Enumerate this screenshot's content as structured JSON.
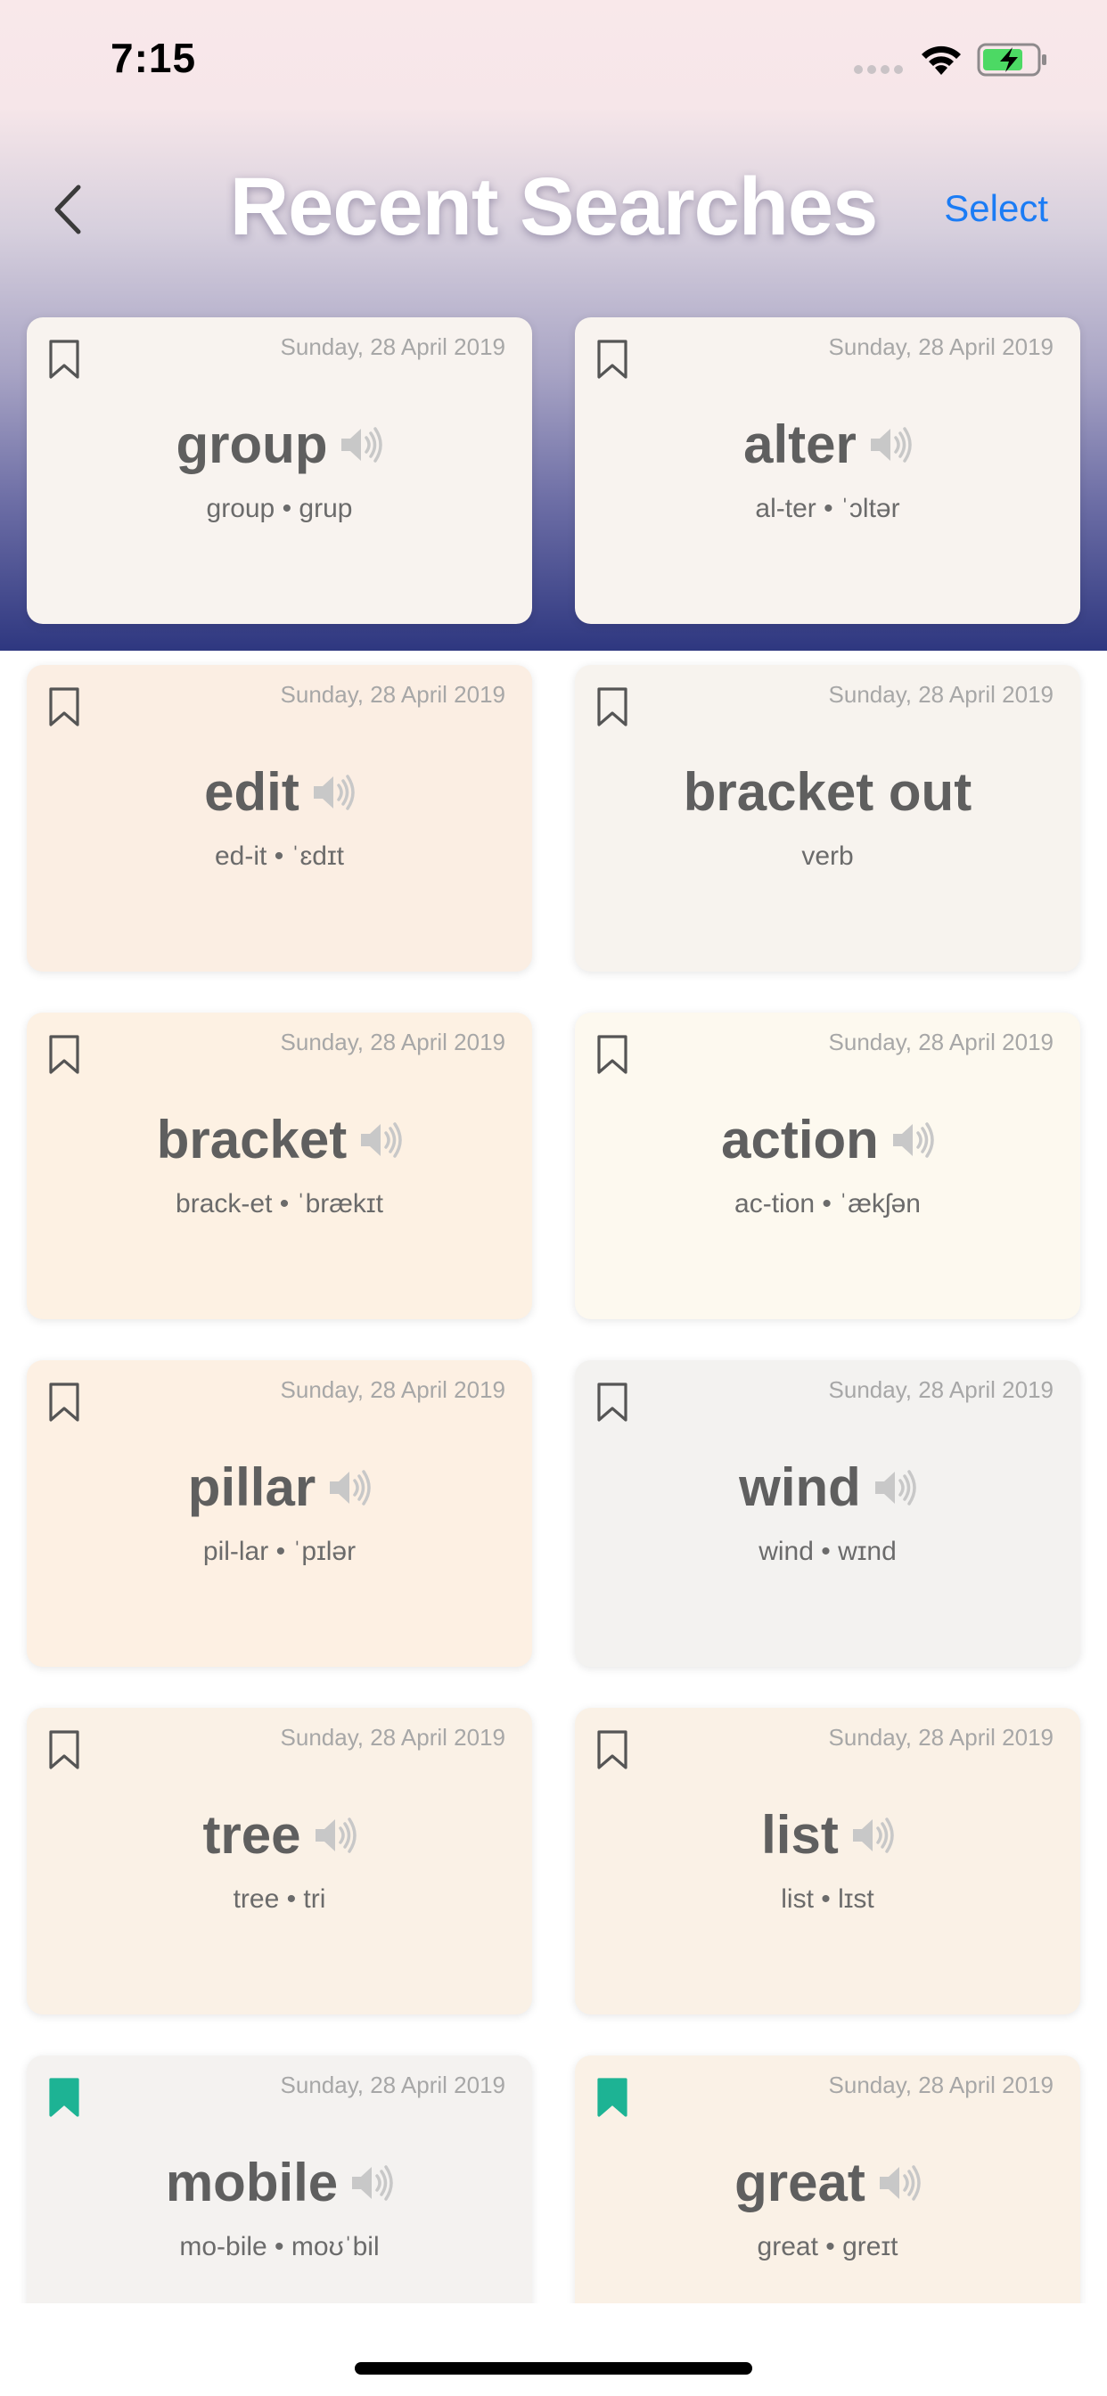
{
  "status_bar": {
    "time": "7:15"
  },
  "nav": {
    "title": "Recent Searches",
    "select_label": "Select"
  },
  "colors": {
    "accent": "#1b7cf5",
    "bookmark_saved": "#1db394",
    "bookmark_unsaved": "#555555"
  },
  "cards": [
    {
      "date": "Sunday, 28 April 2019",
      "word": "group",
      "pronunciation": "group • grup",
      "bookmarked": false,
      "has_audio": true,
      "bg": "#f8f3ef"
    },
    {
      "date": "Sunday, 28 April 2019",
      "word": "alter",
      "pronunciation": "al-ter • ˈɔltər",
      "bookmarked": false,
      "has_audio": true,
      "bg": "#f8f3ef"
    },
    {
      "date": "Sunday, 28 April 2019",
      "word": "edit",
      "pronunciation": "ed-it • ˈɛdɪt",
      "bookmarked": false,
      "has_audio": true,
      "bg": "#fbeee3"
    },
    {
      "date": "Sunday, 28 April 2019",
      "word": "bracket out",
      "pronunciation": "verb",
      "bookmarked": false,
      "has_audio": false,
      "bg": "#f7f3ee"
    },
    {
      "date": "Sunday, 28 April 2019",
      "word": "bracket",
      "pronunciation": "brack-et • ˈbrækɪt",
      "bookmarked": false,
      "has_audio": true,
      "bg": "#fdf1e3"
    },
    {
      "date": "Sunday, 28 April 2019",
      "word": "action",
      "pronunciation": "ac-tion • ˈækʃən",
      "bookmarked": false,
      "has_audio": true,
      "bg": "#fdf9ef"
    },
    {
      "date": "Sunday, 28 April 2019",
      "word": "pillar",
      "pronunciation": "pil-lar • ˈpɪlər",
      "bookmarked": false,
      "has_audio": true,
      "bg": "#fdf0e3"
    },
    {
      "date": "Sunday, 28 April 2019",
      "word": "wind",
      "pronunciation": "wind • wɪnd",
      "bookmarked": false,
      "has_audio": true,
      "bg": "#f3f2f0"
    },
    {
      "date": "Sunday, 28 April 2019",
      "word": "tree",
      "pronunciation": "tree • tri",
      "bookmarked": false,
      "has_audio": true,
      "bg": "#faf1e6"
    },
    {
      "date": "Sunday, 28 April 2019",
      "word": "list",
      "pronunciation": "list • lɪst",
      "bookmarked": false,
      "has_audio": true,
      "bg": "#faf1e6"
    },
    {
      "date": "Sunday, 28 April 2019",
      "word": "mobile",
      "pronunciation": "mo-bile • moʊˈbil",
      "bookmarked": true,
      "has_audio": true,
      "bg": "#f4f2f0"
    },
    {
      "date": "Sunday, 28 April 2019",
      "word": "great",
      "pronunciation": "great • greɪt",
      "bookmarked": true,
      "has_audio": true,
      "bg": "#faf1e6"
    }
  ]
}
